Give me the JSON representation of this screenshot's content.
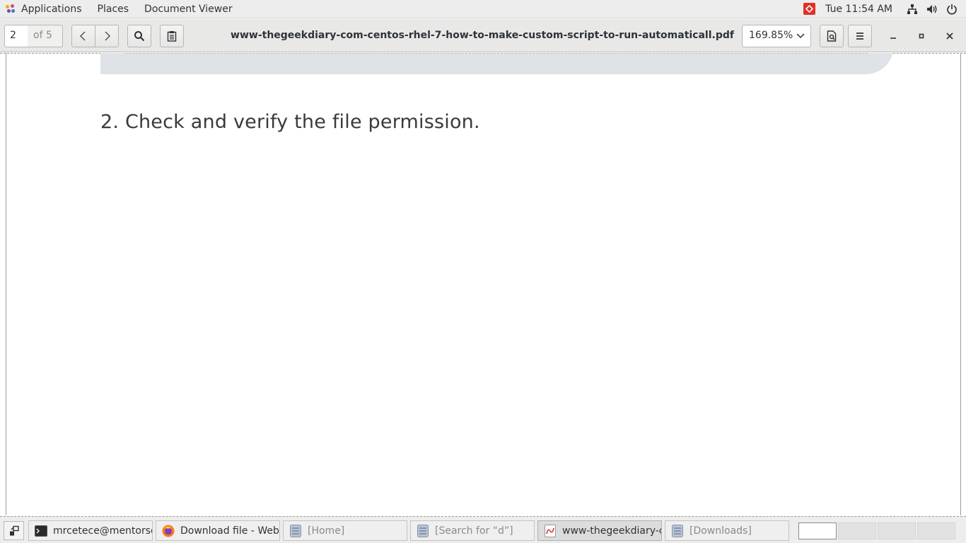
{
  "topbar": {
    "applications_label": "Applications",
    "places_label": "Places",
    "document_viewer_label": "Document Viewer",
    "clock": "Tue 11:54 AM"
  },
  "header": {
    "page_current": "2",
    "page_total": "of 5",
    "document_title": "www-thegeekdiary-com-centos-rhel-7-how-to-make-custom-script-to-run-automaticall.pdf",
    "zoom": "169.85%"
  },
  "document": {
    "heading": "2. Check and verify the file permission."
  },
  "taskbar": {
    "tasks": [
      {
        "label": "mrcetece@mentorse...",
        "icon": "terminal-icon"
      },
      {
        "label": "Download file - Web...",
        "icon": "firefox-icon"
      },
      {
        "label": "[Home]",
        "icon": "file-manager-icon"
      },
      {
        "label": "[Search for “d”]",
        "icon": "file-manager-icon"
      },
      {
        "label": "www-thegeekdiary-c...",
        "icon": "document-viewer-icon"
      },
      {
        "label": "[Downloads]",
        "icon": "file-manager-icon"
      }
    ],
    "workspaces": 4,
    "current_workspace": 1
  },
  "colors": {
    "alert_red": "#e0312a",
    "code_box_bg": "#dfe3e7"
  }
}
